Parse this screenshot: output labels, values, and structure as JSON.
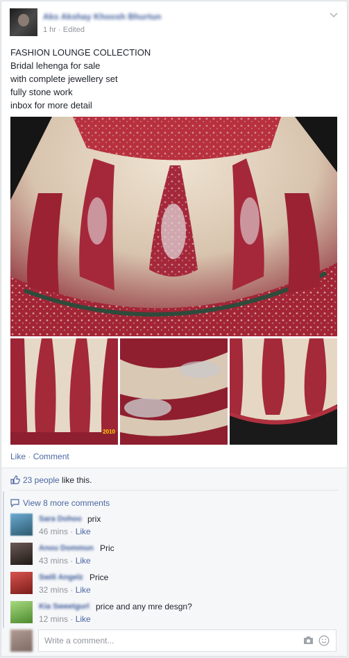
{
  "post": {
    "author": "Aks Akshay Khoosh Bhurtun",
    "time": "1 hr",
    "edited": "Edited",
    "meta_sep": "·",
    "lines": [
      "FASHION LOUNGE COLLECTION",
      "Bridal lehenga for sale",
      "with complete jewellery set",
      "fully stone work",
      "inbox for more detail"
    ],
    "photo_stamp": "2010"
  },
  "actions": {
    "like": "Like",
    "sep": "·",
    "comment": "Comment"
  },
  "ufi": {
    "likes_count": "23 people",
    "likes_suffix": " like this.",
    "view_more": "View 8 more comments",
    "comments": [
      {
        "name": "Sara Dohoo",
        "text": "prix",
        "time": "46 mins",
        "like": "Like",
        "avatar_color": "#5b8fb0"
      },
      {
        "name": "Anou Dommun",
        "text": "Pric",
        "time": "43 mins",
        "like": "Like",
        "avatar_color": "#3a2f2c"
      },
      {
        "name": "Swili Angelz",
        "text": "Price",
        "time": "32 mins",
        "like": "Like",
        "avatar_color": "#c9423c"
      },
      {
        "name": "Kia Sweetgurl",
        "text": "price and any mre desgn?",
        "time": "12 mins",
        "like": "Like",
        "avatar_color": "#8cc46a"
      }
    ],
    "write_placeholder": "Write a comment..."
  },
  "colors": {
    "link": "#4b67a1",
    "name": "#3b5998",
    "muted": "#90949c",
    "lehenga_red": "#b3303f",
    "lehenga_cream": "#e9dccb"
  }
}
